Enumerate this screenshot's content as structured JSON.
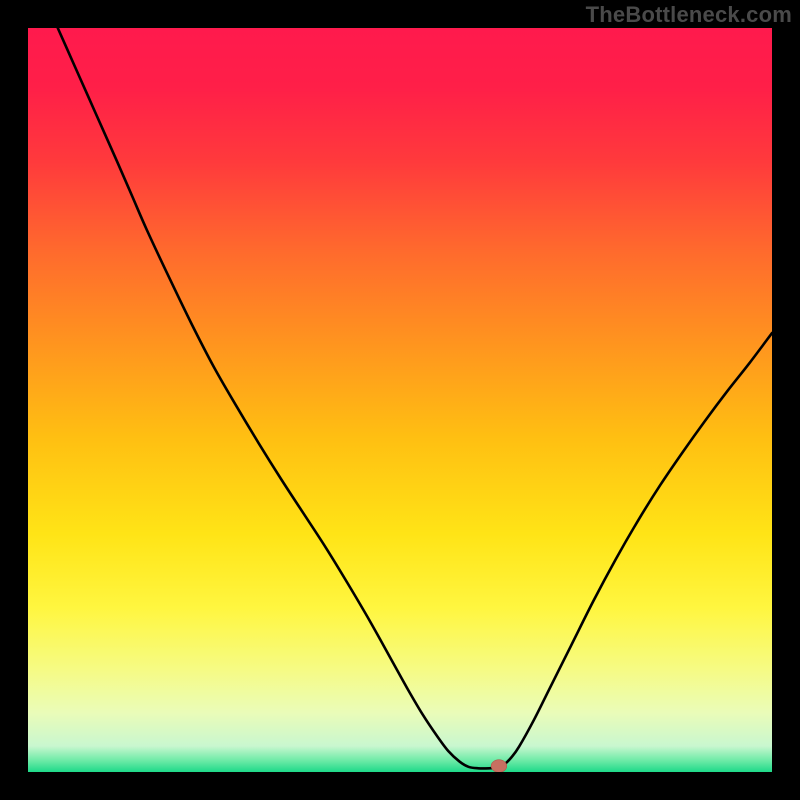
{
  "watermark": {
    "text": "TheBottleneck.com"
  },
  "chart_data": {
    "type": "line",
    "title": "",
    "xlabel": "",
    "ylabel": "",
    "xlim": [
      0,
      100
    ],
    "ylim": [
      0,
      100
    ],
    "grid": false,
    "legend": false,
    "background_gradient_stops": [
      {
        "offset": 0.0,
        "color": "#ff1a4d"
      },
      {
        "offset": 0.08,
        "color": "#ff1f48"
      },
      {
        "offset": 0.18,
        "color": "#ff3a3c"
      },
      {
        "offset": 0.3,
        "color": "#ff6a2d"
      },
      {
        "offset": 0.42,
        "color": "#ff931f"
      },
      {
        "offset": 0.55,
        "color": "#ffbf12"
      },
      {
        "offset": 0.68,
        "color": "#ffe416"
      },
      {
        "offset": 0.78,
        "color": "#fff640"
      },
      {
        "offset": 0.86,
        "color": "#f6fb82"
      },
      {
        "offset": 0.92,
        "color": "#eafcb8"
      },
      {
        "offset": 0.965,
        "color": "#c9f7cf"
      },
      {
        "offset": 0.985,
        "color": "#6beaa6"
      },
      {
        "offset": 1.0,
        "color": "#1ed989"
      }
    ],
    "series": [
      {
        "name": "bottleneck-curve",
        "color": "#000000",
        "width": 2.6,
        "points": [
          {
            "x": 4.0,
            "y": 100.0
          },
          {
            "x": 6.0,
            "y": 95.5
          },
          {
            "x": 8.0,
            "y": 91.0
          },
          {
            "x": 10.0,
            "y": 86.5
          },
          {
            "x": 12.0,
            "y": 82.0
          },
          {
            "x": 14.0,
            "y": 77.4
          },
          {
            "x": 16.0,
            "y": 72.8
          },
          {
            "x": 19.0,
            "y": 66.4
          },
          {
            "x": 22.0,
            "y": 60.2
          },
          {
            "x": 25.0,
            "y": 54.4
          },
          {
            "x": 28.0,
            "y": 49.2
          },
          {
            "x": 31.0,
            "y": 44.2
          },
          {
            "x": 34.0,
            "y": 39.4
          },
          {
            "x": 37.0,
            "y": 34.8
          },
          {
            "x": 40.0,
            "y": 30.2
          },
          {
            "x": 43.0,
            "y": 25.3
          },
          {
            "x": 46.0,
            "y": 20.2
          },
          {
            "x": 49.0,
            "y": 14.8
          },
          {
            "x": 51.0,
            "y": 11.2
          },
          {
            "x": 53.0,
            "y": 7.8
          },
          {
            "x": 55.0,
            "y": 4.8
          },
          {
            "x": 56.5,
            "y": 2.8
          },
          {
            "x": 58.0,
            "y": 1.4
          },
          {
            "x": 59.2,
            "y": 0.7
          },
          {
            "x": 60.5,
            "y": 0.5
          },
          {
            "x": 62.0,
            "y": 0.5
          },
          {
            "x": 63.2,
            "y": 0.6
          },
          {
            "x": 64.0,
            "y": 1.0
          },
          {
            "x": 65.0,
            "y": 2.0
          },
          {
            "x": 66.0,
            "y": 3.4
          },
          {
            "x": 68.0,
            "y": 7.0
          },
          {
            "x": 70.0,
            "y": 11.0
          },
          {
            "x": 73.0,
            "y": 17.0
          },
          {
            "x": 76.0,
            "y": 23.0
          },
          {
            "x": 79.0,
            "y": 28.6
          },
          {
            "x": 82.0,
            "y": 33.8
          },
          {
            "x": 85.0,
            "y": 38.6
          },
          {
            "x": 88.0,
            "y": 43.0
          },
          {
            "x": 91.0,
            "y": 47.2
          },
          {
            "x": 94.0,
            "y": 51.2
          },
          {
            "x": 97.0,
            "y": 55.0
          },
          {
            "x": 100.0,
            "y": 59.0
          }
        ]
      }
    ],
    "marker": {
      "x": 63.3,
      "y": 0.8,
      "rx": 1.05,
      "ry": 0.85,
      "fill": "#c77061",
      "stroke": "#b3584a",
      "stroke_width": 0.6
    }
  }
}
